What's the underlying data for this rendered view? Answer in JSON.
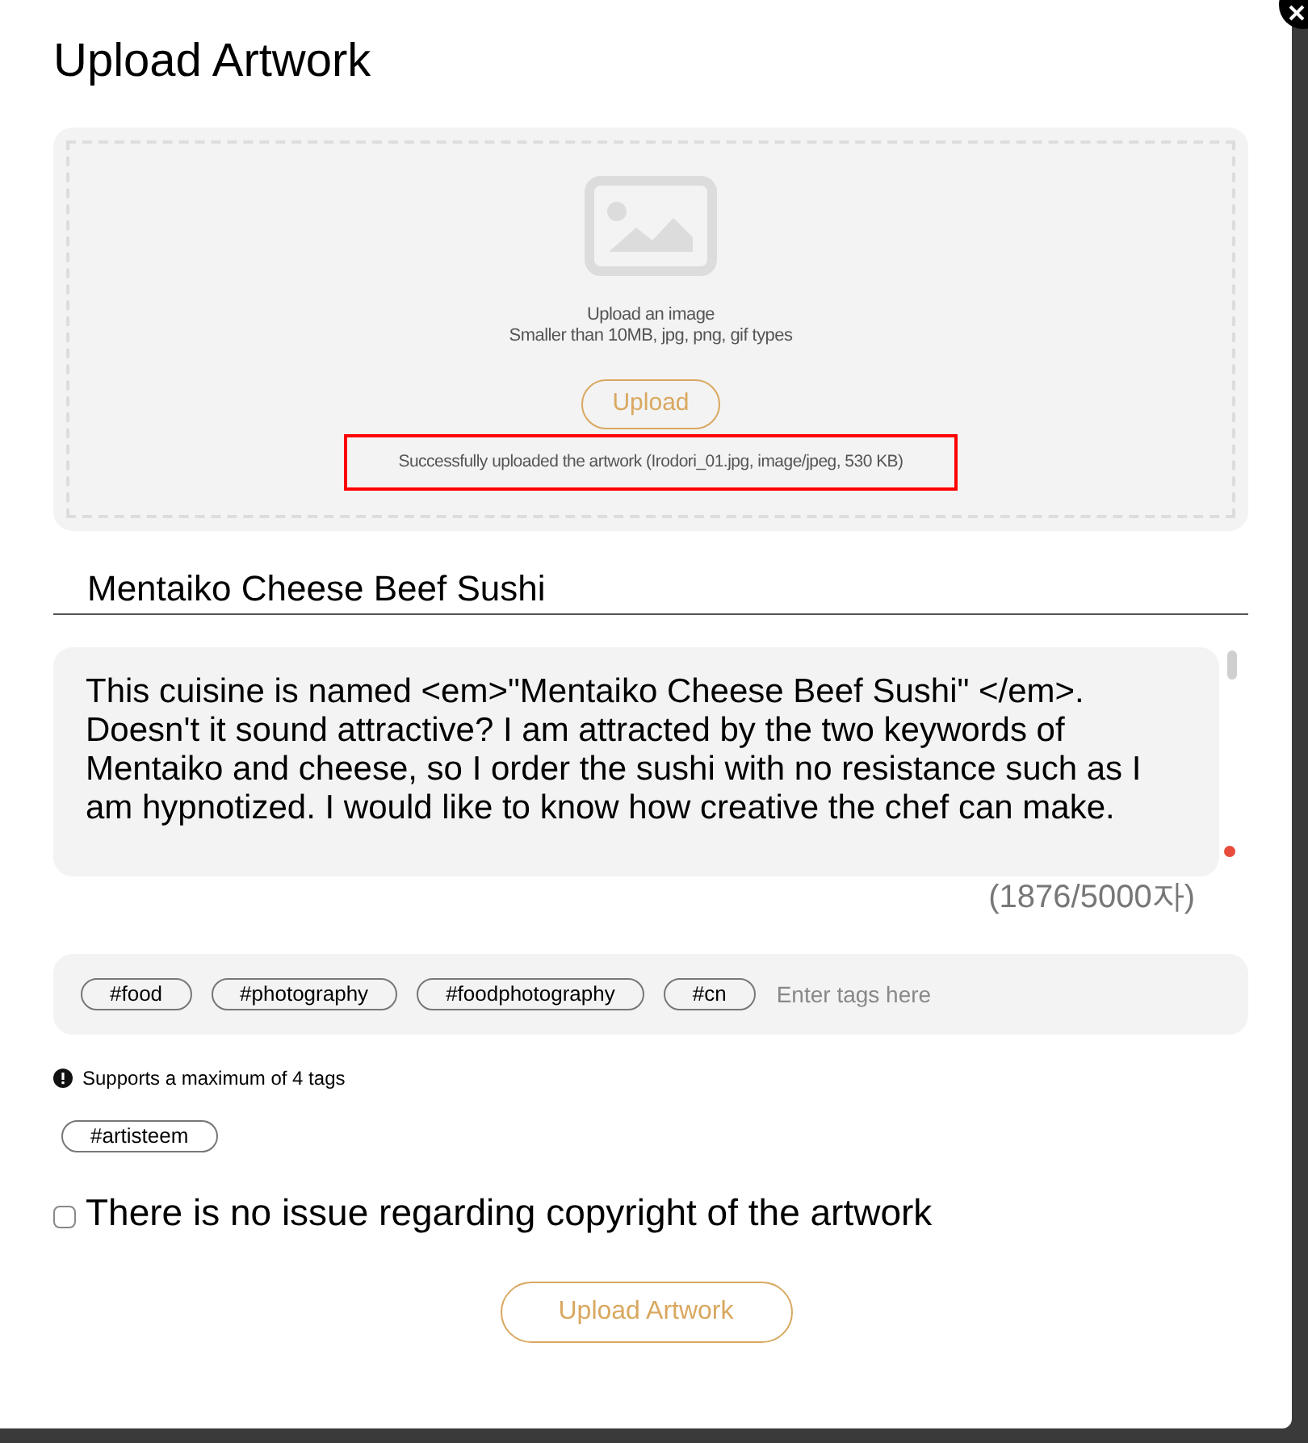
{
  "dialog": {
    "title": "Upload Artwork"
  },
  "dropzone": {
    "prompt": "Upload an image",
    "hint": "Smaller than 10MB, jpg, png, gif types",
    "button": "Upload",
    "status": "Successfully uploaded the artwork (Irodori_01.jpg, image/jpeg, 530 KB)",
    "status_highlighted": true
  },
  "title_field": {
    "value": "Mentaiko Cheese Beef Sushi"
  },
  "description": {
    "value": "This cuisine is named <em>\"Mentaiko Cheese Beef Sushi\" </em>. Doesn't it sound attractive? I am attracted by the two keywords of Mentaiko and cheese, so I order the sushi with no resistance such as I am hypnotized. I would like to know how creative the chef can make.",
    "counter": "(1876/5000자)"
  },
  "tags": {
    "items": [
      "#food",
      "#photography",
      "#foodphotography",
      "#cn"
    ],
    "placeholder": "Enter tags here",
    "notice": "Supports a maximum of 4 tags",
    "suggested": [
      "#artisteem"
    ]
  },
  "copyright": {
    "label": "There is no issue regarding copyright of the artwork",
    "checked": false
  },
  "submit": "Upload Artwork"
}
